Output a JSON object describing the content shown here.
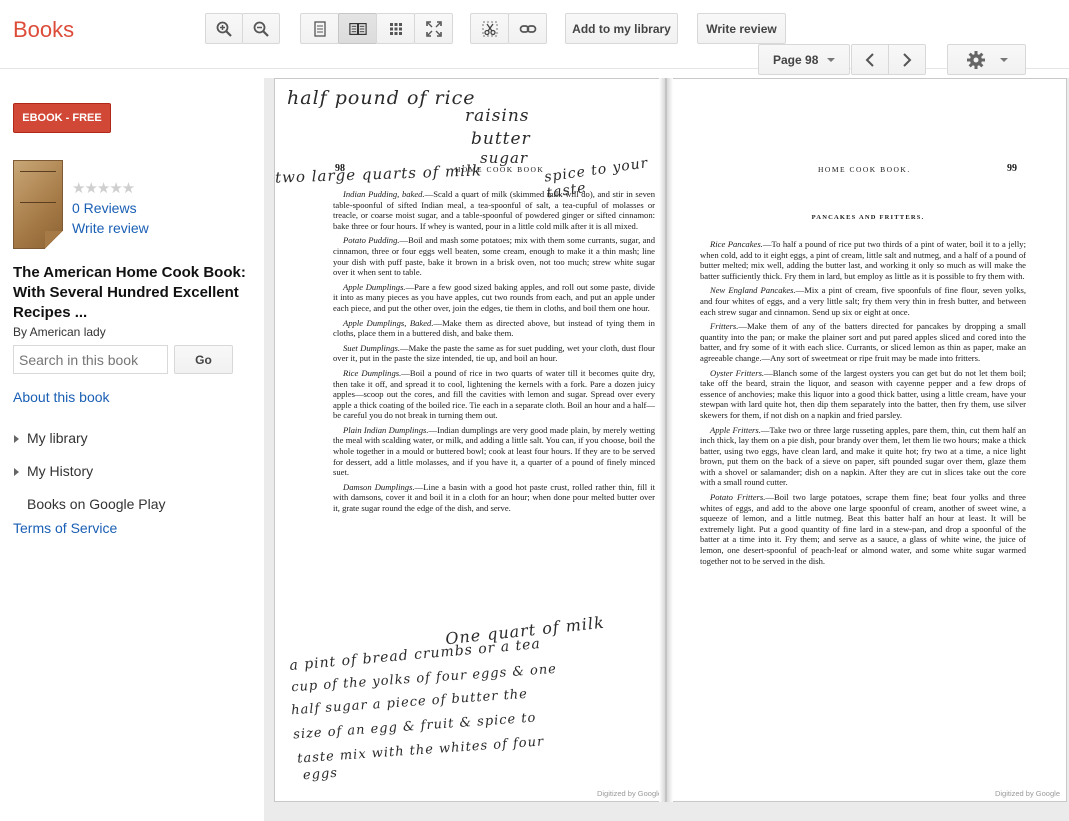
{
  "app": {
    "brand": "Books"
  },
  "toolbar": {
    "zoom_in_icon": "zoom-in-icon",
    "zoom_out_icon": "zoom-out-icon",
    "add_library_label": "Add to my library",
    "write_review_label": "Write review",
    "page_label": "Page 98"
  },
  "sidebar": {
    "ebook_label": "EBOOK - FREE",
    "stars": "★★★★★",
    "reviews_label": "0 Reviews",
    "write_review_label": "Write review",
    "book_title": "The American Home Cook Book: With Several Hundred Excellent Recipes ...",
    "author": "By American lady",
    "search_placeholder": "Search in this book",
    "go_label": "Go",
    "about_label": "About this book",
    "my_library_label": "My library",
    "my_history_label": "My History",
    "books_play_label": "Books on Google Play",
    "tos_label": "Terms of Service"
  },
  "viewer": {
    "left_page": {
      "page_number": "98",
      "running_head": "HOME COOK BOOK",
      "paragraphs": [
        {
          "title": "Indian Pudding, baked.",
          "text": "—Scald a quart of milk (skimmed milk will do), and stir in seven table-spoonful of sifted Indian meal, a tea-spoonful of salt, a tea-cupful of molasses or treacle, or coarse moist sugar, and a table-spoonful of powdered ginger or sifted cinnamon: bake three or four hours. If whey is wanted, pour in a little cold milk after it is all mixed."
        },
        {
          "title": "Potato Pudding.",
          "text": "—Boil and mash some potatoes; mix with them some currants, sugar, and cinnamon, three or four eggs well beaten, some cream, enough to make it a thin mash; line your dish with puff paste, bake it brown in a brisk oven, not too much; strew white sugar over it when sent to table."
        },
        {
          "title": "Apple Dumplings.",
          "text": "—Pare a few good sized baking apples, and roll out some paste, divide it into as many pieces as you have apples, cut two rounds from each, and put an apple under each piece, and put the other over, join the edges, tie them in cloths, and boil them one hour."
        },
        {
          "title": "Apple Dumplings, Baked.",
          "text": "—Make them as directed above, but instead of tying them in cloths, place them in a buttered dish, and bake them."
        },
        {
          "title": "Suet Dumplings.",
          "text": "—Make the paste the same as for suet pudding, wet your cloth, dust flour over it, put in the paste the size intended, tie up, and boil an hour."
        },
        {
          "title": "Rice Dumplings.",
          "text": "—Boil a pound of rice in two quarts of water till it becomes quite dry, then take it off, and spread it to cool, lightening the kernels with a fork. Pare a dozen juicy apples—scoop out the cores, and fill the cavities with lemon and sugar. Spread over every apple a thick coating of the boiled rice. Tie each in a separate cloth. Boil an hour and a half—be careful you do not break in turning them out."
        },
        {
          "title": "Plain Indian Dumplings.",
          "text": "—Indian dumplings are very good made plain, by merely wetting the meal with scalding water, or milk, and adding a little salt. You can, if you choose, boil the whole together in a mould or buttered bowl; cook at least four hours. If they are to be served for dessert, add a little molasses, and if you have it, a quarter of a pound of finely minced suet."
        },
        {
          "title": "Damson Dumplings.",
          "text": "—Line a basin with a good hot paste crust, rolled rather thin, fill it with damsons, cover it and boil it in a cloth for an hour; when done pour melted butter over it, grate sugar round the edge of the dish, and serve."
        }
      ],
      "watermark": "Digitized by Google"
    },
    "right_page": {
      "page_number": "99",
      "running_head": "HOME COOK BOOK.",
      "section_title": "PANCAKES AND FRITTERS.",
      "paragraphs": [
        {
          "title": "Rice Pancakes.",
          "text": "—To half a pound of rice put two thirds of a pint of water, boil it to a jelly; when cold, add to it eight eggs, a pint of cream, little salt and nutmeg, and a half of a pound of butter melted; mix well, adding the butter last, and working it only so much as will make the batter sufficiently thick. Fry them in lard, but employ as little as it is possible to fry them with."
        },
        {
          "title": "New England Pancakes.",
          "text": "—Mix a pint of cream, five spoonfuls of fine flour, seven yolks, and four whites of eggs, and a very little salt; fry them very thin in fresh butter, and between each strew sugar and cinnamon. Send up six or eight at once."
        },
        {
          "title": "Fritters.",
          "text": "—Make them of any of the batters directed for pancakes by dropping a small quantity into the pan; or make the plainer sort and put pared apples sliced and cored into the batter, and fry some of it with each slice. Currants, or sliced lemon as thin as paper, make an agreeable change.—Any sort of sweetmeat or ripe fruit may be made into fritters."
        },
        {
          "title": "Oyster Fritters.",
          "text": "—Blanch some of the largest oysters you can get but do not let them boil; take off the beard, strain the liquor, and season with cayenne pepper and a few drops of essence of anchovies; make this liquor into a good thick batter, using a little cream, have your stewpan with lard quite hot, then dip them separately into the batter, then fry them, use silver skewers for them, if not dish on a napkin and fried parsley."
        },
        {
          "title": "Apple Fritters.",
          "text": "—Take two or three large russeting apples, pare them, thin, cut them half an inch thick, lay them on a pie dish, pour brandy over them, let them lie two hours; make a thick batter, using two eggs, have clean lard, and make it quite hot; fry two at a time, a nice light brown, put them on the back of a sieve on paper, sift pounded sugar over them, glaze them with a shovel or salamander; dish on a napkin. After they are cut in slices take out the core with a small round cutter."
        },
        {
          "title": "Potato Fritters.",
          "text": "—Boil two large potatoes, scrape them fine; beat four yolks and three whites of eggs, and add to the above one large spoonful of cream, another of sweet wine, a squeeze of lemon, and a little nutmeg. Beat this batter half an hour at least. It will be extremely light. Put a good quantity of fine lard in a stew-pan, and drop a spoonful of the batter at a time into it. Fry them; and serve as a sauce, a glass of white wine, the juice of lemon, one desert-spoonful of peach-leaf or almond water, and some white sugar warmed together not to be served in the dish."
        }
      ],
      "watermark": "Digitized by Google"
    },
    "handwriting": {
      "top": [
        "half pound of rice",
        "raisins",
        "butter",
        "sugar"
      ],
      "top_left": "two large quarts of milk",
      "top_right": "spice to your taste",
      "bottom": [
        "One quart of milk",
        "a pint of bread crumbs or a tea",
        "cup of the yolks of four eggs & one",
        "half sugar a piece of butter the",
        "size of an egg & fruit & spice to",
        "taste mix with the whites of four",
        "eggs"
      ]
    }
  }
}
